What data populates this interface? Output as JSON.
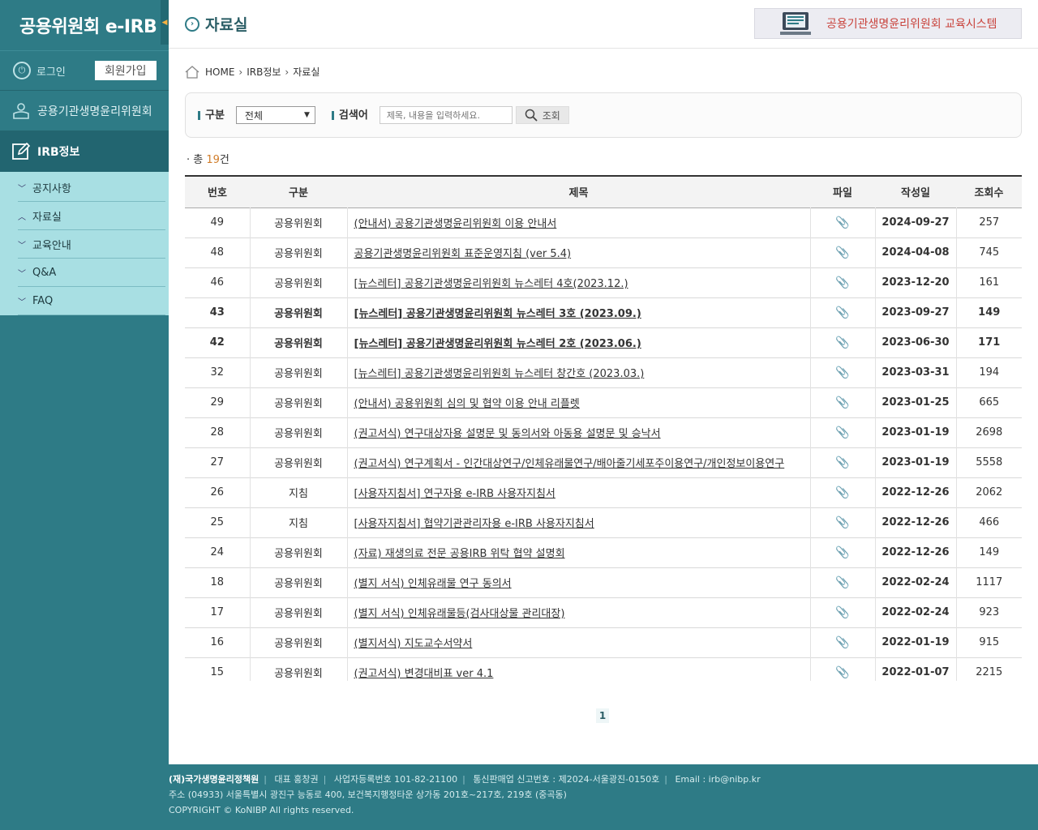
{
  "sidebar": {
    "logo": "공용위원회 e-IRB",
    "collapse_icon": "◀",
    "login_label": "로그인",
    "signup_label": "회원가입",
    "menu_committee": "공용기관생명윤리위원회",
    "menu_irb": "IRB정보",
    "submenu": [
      {
        "label": "공지사항",
        "icon": "chevron-down"
      },
      {
        "label": "자료실",
        "icon": "chevron-up"
      },
      {
        "label": "교육안내",
        "icon": "chevron-down"
      },
      {
        "label": "Q&A",
        "icon": "chevron-down"
      },
      {
        "label": "FAQ",
        "icon": "chevron-down"
      }
    ]
  },
  "header": {
    "title": "자료실",
    "edu_banner": "공용기관생명윤리위원회 교육시스템"
  },
  "breadcrumb": [
    "HOME",
    "IRB정보",
    "자료실"
  ],
  "search": {
    "category_label": "구분",
    "category_value": "전체",
    "keyword_label": "검색어",
    "placeholder": "제목, 내용을 입력하세요.",
    "button": "조회"
  },
  "total": {
    "prefix": "총",
    "count": "19",
    "suffix": "건"
  },
  "table": {
    "headers": [
      "번호",
      "구분",
      "제목",
      "파일",
      "작성일",
      "조회수"
    ],
    "rows": [
      {
        "no": "49",
        "cat": "공용위원회",
        "title": "(안내서) 공용기관생명윤리위원회 이용 안내서",
        "date": "2024-09-27",
        "views": "257",
        "bold": false
      },
      {
        "no": "48",
        "cat": "공용위원회",
        "title": "공용기관생명윤리위원회 표준운영지침 (ver 5.4)",
        "date": "2024-04-08",
        "views": "745",
        "bold": false
      },
      {
        "no": "46",
        "cat": "공용위원회",
        "title": "[뉴스레터] 공용기관생명윤리위원회 뉴스레터 4호(2023.12.)",
        "date": "2023-12-20",
        "views": "161",
        "bold": false
      },
      {
        "no": "43",
        "cat": "공용위원회",
        "title": "[뉴스레터] 공용기관생명윤리위원회 뉴스레터 3호 (2023.09.)",
        "date": "2023-09-27",
        "views": "149",
        "bold": true
      },
      {
        "no": "42",
        "cat": "공용위원회",
        "title": "[뉴스레터] 공용기관생명윤리위원회 뉴스레터 2호 (2023.06.)",
        "date": "2023-06-30",
        "views": "171",
        "bold": true
      },
      {
        "no": "32",
        "cat": "공용위원회",
        "title": "[뉴스레터] 공용기관생명윤리위원회 뉴스레터 창간호 (2023.03.)",
        "date": "2023-03-31",
        "views": "194",
        "bold": false
      },
      {
        "no": "29",
        "cat": "공용위원회",
        "title": "(안내서) 공용위원회 심의 및 협약 이용 안내 리플렛",
        "date": "2023-01-25",
        "views": "665",
        "bold": false
      },
      {
        "no": "28",
        "cat": "공용위원회",
        "title": "(권고서식) 연구대상자용 설명문 및 동의서와 아동용 설명문 및 승낙서",
        "date": "2023-01-19",
        "views": "2698",
        "bold": false
      },
      {
        "no": "27",
        "cat": "공용위원회",
        "title": "(권고서식) 연구계획서 - 인간대상연구/인체유래물연구/배아줄기세포주이용연구/개인정보이용연구",
        "date": "2023-01-19",
        "views": "5558",
        "bold": false
      },
      {
        "no": "26",
        "cat": "지침",
        "title": "[사용자지침서] 연구자용 e-IRB 사용자지침서",
        "date": "2022-12-26",
        "views": "2062",
        "bold": false
      },
      {
        "no": "25",
        "cat": "지침",
        "title": "[사용자지침서] 협약기관관리자용 e-IRB 사용자지침서",
        "date": "2022-12-26",
        "views": "466",
        "bold": false
      },
      {
        "no": "24",
        "cat": "공용위원회",
        "title": "(자료) 재생의료 전문 공용IRB 위탁 협약 설명회",
        "date": "2022-12-26",
        "views": "149",
        "bold": false
      },
      {
        "no": "18",
        "cat": "공용위원회",
        "title": "(별지 서식) 인체유래물 연구 동의서",
        "date": "2022-02-24",
        "views": "1117",
        "bold": false
      },
      {
        "no": "17",
        "cat": "공용위원회",
        "title": "(별지 서식) 인체유래물등(검사대상물 관리대장)",
        "date": "2022-02-24",
        "views": "923",
        "bold": false
      },
      {
        "no": "16",
        "cat": "공용위원회",
        "title": "(별지서식) 지도교수서약서",
        "date": "2022-01-19",
        "views": "915",
        "bold": false
      },
      {
        "no": "15",
        "cat": "공용위원회",
        "title": "(권고서식) 변경대비표 ver 4.1",
        "date": "2022-01-07",
        "views": "2215",
        "bold": false
      }
    ]
  },
  "pagination": {
    "current": "1"
  },
  "footer": {
    "org": "(재)국가생명윤리정책원",
    "ceo": "대표 홍창권",
    "biz_no": "사업자등록번호 101-82-21100",
    "mail_order": "통신판매업 신고번호 : 제2024-서울광진-0150호",
    "email": "Email : irb@nibp.kr",
    "address": "주소 (04933) 서울특별시 광진구 능동로 400, 보건복지행정타운 상가동 201호~217호, 219호 (중곡동)",
    "copyright": "COPYRIGHT © KoNIBP All rights reserved."
  }
}
